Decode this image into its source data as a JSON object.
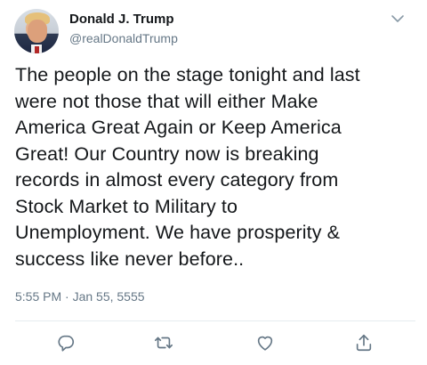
{
  "author": {
    "display_name": "Donald J. Trump",
    "handle": "@realDonaldTrump"
  },
  "tweet": {
    "text": "The people on the stage tonight and last\nwere not those that will either Make\nAmerica Great Again or Keep America\nGreat! Our Country now is breaking\nrecords in almost every category from\nStock Market to Military to\nUnemployment. We have prosperity &\nsuccess like never before..",
    "timestamp": "5:55 PM · Jan 55, 5555"
  },
  "icons": {
    "menu": "chevron-down-icon",
    "reply": "reply-icon",
    "retweet": "retweet-icon",
    "like": "heart-icon",
    "share": "share-icon"
  },
  "colors": {
    "text": "#14171a",
    "secondary": "#657786",
    "icon": "#657786",
    "divider": "#e6ecf0"
  }
}
